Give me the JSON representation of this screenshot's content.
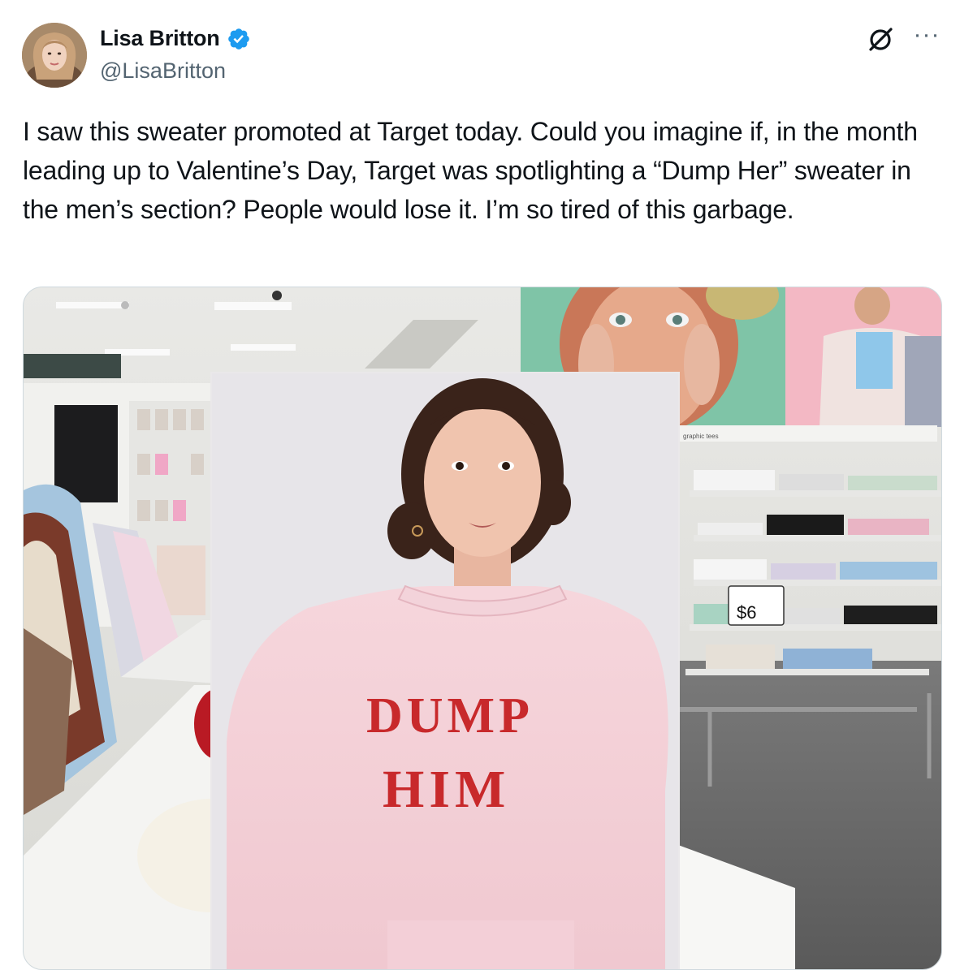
{
  "tweet": {
    "author": {
      "display_name": "Lisa Britton",
      "handle": "@LisaBritton",
      "verified": true
    },
    "text": "I saw this sweater promoted at Target today. Could you imagine if, in the month leading up to Valentine’s Day, Target was spotlighting a “Dump Her” sweater in the men’s section? People would lose it. I’m so tired of this garbage.",
    "actions": {
      "grok_icon": "grok-icon",
      "more_icon": "more-icon",
      "more_label": "···"
    }
  },
  "media": {
    "sweater_text_line1": "DUMP",
    "sweater_text_line2": "HIM",
    "price_tag": "$6",
    "store_sign": "graphic tees"
  },
  "colors": {
    "verified_blue": "#1d9bf0",
    "text_primary": "#0f1419",
    "text_secondary": "#536471",
    "border": "#cfd9de",
    "sweater_pink": "#f2cfd6",
    "sweater_text_red": "#c8292b"
  }
}
